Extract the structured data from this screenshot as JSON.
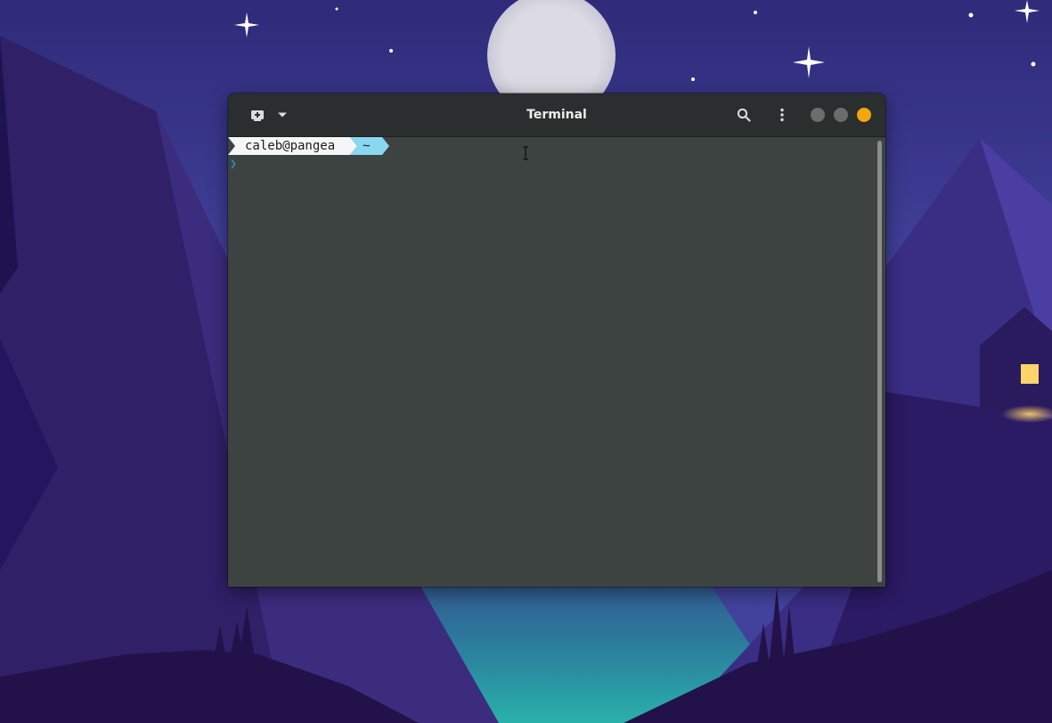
{
  "window": {
    "title": "Terminal"
  },
  "headerbar": {
    "icons": [
      "new-tab-icon",
      "chevron-down-icon",
      "search-icon",
      "kebab-menu-icon"
    ],
    "window_controls": {
      "minimize_color": "#6c6c6c",
      "maximize_color": "#6c6c6c",
      "close_color": "#f5a511"
    }
  },
  "terminal": {
    "prompt_user_host": "caleb@pangea",
    "prompt_dir": "~",
    "input_symbol": "❯",
    "colors": {
      "background": "#3d4340",
      "user_segment": "#f5f6f5",
      "dir_segment": "#8ad7f0",
      "input_symbol": "#2a8dbb"
    }
  },
  "colors": {
    "sky_top": "#2f2b7a",
    "sky_mid": "#4a4aa8",
    "moon": "#dcdbe4",
    "mountain_dark": "#2a1556",
    "mountain_mid": "#3a2775",
    "lake": "#2aa3a8",
    "window_light": "#ffd36a"
  }
}
